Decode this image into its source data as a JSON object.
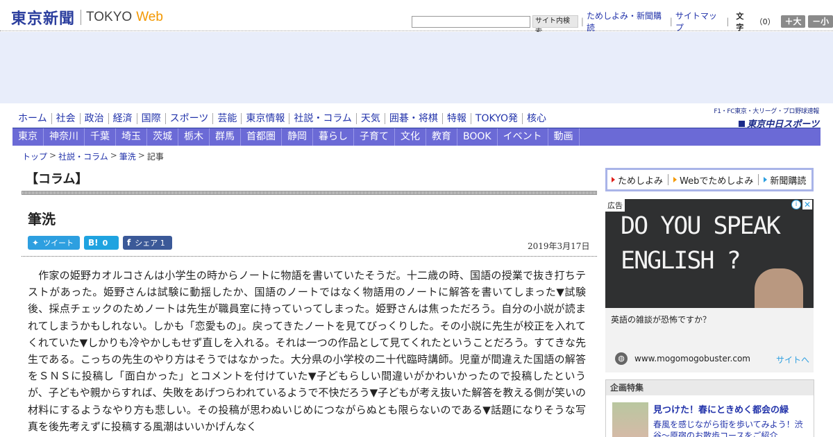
{
  "header": {
    "logo_jp": "東京新聞",
    "logo_en_a": "TOKYO",
    "logo_en_b": "Web",
    "search_button": "サイト内検索",
    "link_trial": "ためしよみ・新聞購読",
    "link_sitemap": "サイトマップ",
    "font_label": "文字",
    "font_size": "（0）",
    "size_up": "＋大",
    "size_down": "－小"
  },
  "nav_main": [
    "ホーム",
    "社会",
    "政治",
    "経済",
    "国際",
    "スポーツ",
    "芸能",
    "東京情報",
    "社説・コラム",
    "天気",
    "囲碁・将棋",
    "特報",
    "TOKYO発",
    "核心"
  ],
  "nav_region": [
    "東京",
    "神奈川",
    "千葉",
    "埼玉",
    "茨城",
    "栃木",
    "群馬",
    "首都圏",
    "静岡",
    "暮らし",
    "子育て",
    "文化",
    "教育",
    "BOOK",
    "イベント",
    "動画"
  ],
  "sports": {
    "sub": "F1・FC東京・大リーグ・プロ野球速報",
    "main": "東京中日スポーツ"
  },
  "breadcrumb": {
    "top": "トップ",
    "section": "社説・コラム",
    "page": "筆洗",
    "current": "記事"
  },
  "article": {
    "section_title": "【コラム】",
    "title": "筆洗",
    "date": "2019年3月17日",
    "share": {
      "tweet": "ツイート",
      "hatena_count": "0",
      "facebook": "シェア",
      "facebook_count": "1"
    },
    "body": "　作家の姫野カオルコさんは小学生の時からノートに物語を書いていたそうだ。十二歳の時、国語の授業で抜き打ちテストがあった。姫野さんは試験に動揺したか、国語のノートではなく物語用のノートに解答を書いてしまった▼試験後、採点チェックのためノートは先生が職員室に持っていってしまった。姫野さんは焦っただろう。自分の小説が読まれてしまうかもしれない。しかも「恋愛もの」。戻ってきたノートを見てびっくりした。その小説に先生が校正を入れてくれていた▼しかりも冷やかしもせず直しを入れる。それは一つの作品として見てくれたということだろう。すてきな先生である。こっちの先生のやり方はそうではなかった。大分県の小学校の二十代臨時講師。児童が間違えた国語の解答をＳＮＳに投稿し「面白かった」とコメントを付けていた▼子どもらしい間違いがかわいかったので投稿したというが、子どもや親からすれば、失敗をあげつらわれているようで不快だろう▼子どもが考え抜いた解答を教える側が笑いの材料にするようなやり方も悲しい。その投稿が思わぬいじめにつながらぬとも限らないのである▼話題になりそうな写真を後先考えずに投稿する風潮はいいかげんなく"
  },
  "sidebar": {
    "links": [
      "ためしよみ",
      "Webでためしよみ",
      "新聞購読"
    ],
    "ad": {
      "badge": "広告",
      "image_text_1": "DO YOU SPEAK",
      "image_text_2": "ENGLISH ?",
      "caption": "英語の雑談が恐怖ですか？",
      "url": "www.mogomogobuster.com",
      "cta": "サイトへ"
    },
    "feature": {
      "heading": "企画特集",
      "title": "見つけた！春にときめく都会の緑",
      "desc": "春風を感じながら街を歩いてみよう！渋谷～原宿のお散歩コースをご紹介"
    }
  }
}
